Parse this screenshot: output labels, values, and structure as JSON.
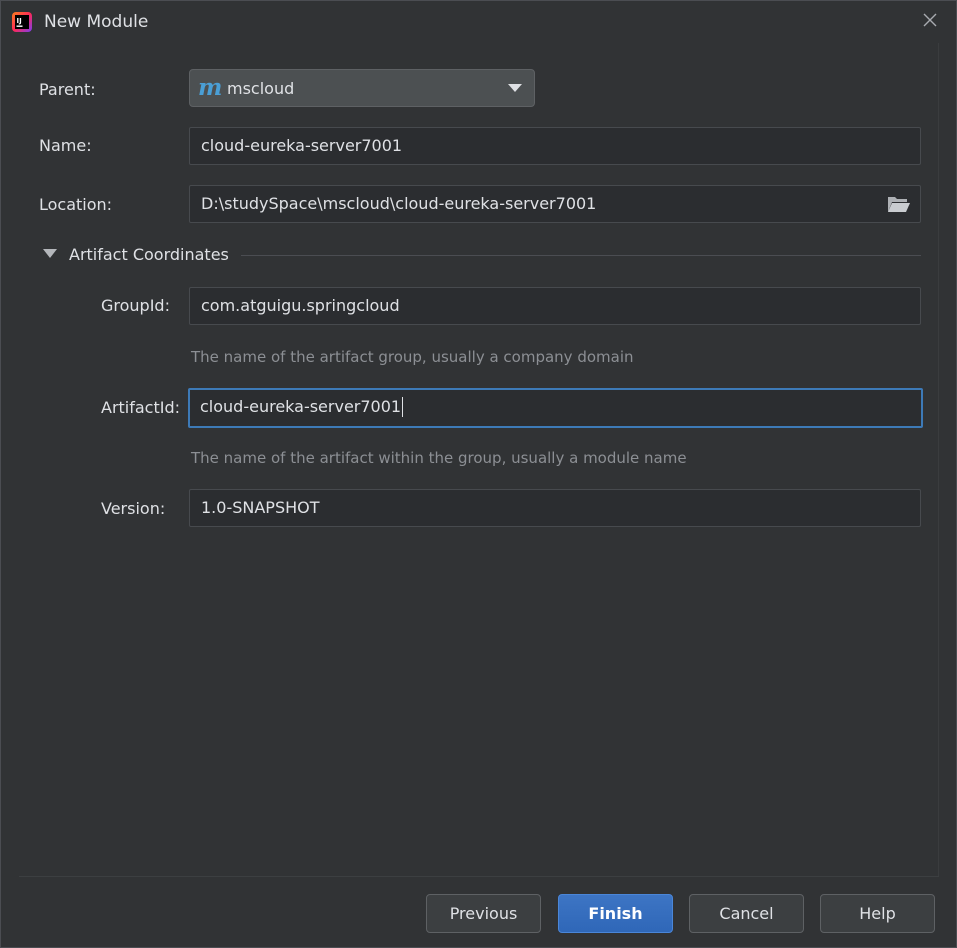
{
  "window": {
    "title": "New Module"
  },
  "form": {
    "parent": {
      "label": "Parent:",
      "value": "mscloud",
      "icon": "maven-icon"
    },
    "name": {
      "label": "Name:",
      "value": "cloud-eureka-server7001"
    },
    "location": {
      "label": "Location:",
      "value": "D:\\studySpace\\mscloud\\cloud-eureka-server7001",
      "icon": "folder-open-icon"
    }
  },
  "artifact_coordinates": {
    "section_title": "Artifact Coordinates",
    "expanded": true,
    "group_id": {
      "label": "GroupId:",
      "value": "com.atguigu.springcloud",
      "hint": "The name of the artifact group, usually a company domain"
    },
    "artifact_id": {
      "label": "ArtifactId:",
      "value": "cloud-eureka-server7001",
      "hint": "The name of the artifact within the group, usually a module name"
    },
    "version": {
      "label": "Version:",
      "value": "1.0-SNAPSHOT"
    }
  },
  "buttons": {
    "previous": "Previous",
    "finish": "Finish",
    "cancel": "Cancel",
    "help": "Help"
  },
  "colors": {
    "background": "#313335",
    "accent": "#3d7ab7",
    "primary_button": "#2f67b8",
    "hint_text": "#8c8f94"
  }
}
